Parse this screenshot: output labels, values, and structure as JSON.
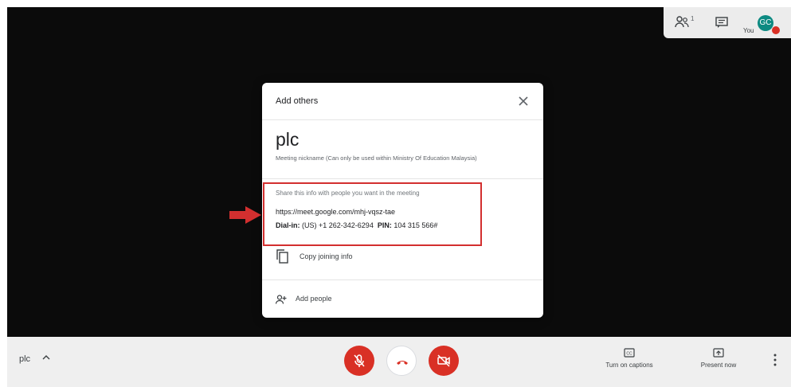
{
  "top_panel": {
    "participants_icon": "people-icon",
    "participant_count": "1",
    "chat_icon": "chat-icon",
    "you_label": "You",
    "avatar_initials": "GC"
  },
  "dialog": {
    "title": "Add others",
    "close_icon": "close-icon",
    "nickname": "plc",
    "nickname_note": "Meeting nickname (Can only be used within Ministry Of Education Malaysia)",
    "share_note": "Share this info with people you want in the meeting",
    "meet_url": "https://meet.google.com/mhj-vqsz-tae",
    "dial_in_label": "Dial-in:",
    "dial_in_value": "(US) +1 262-342-6294",
    "pin_label": "PIN:",
    "pin_value": "104 315 566#",
    "copy_label": "Copy joining info",
    "copy_icon": "copy-icon",
    "add_people_label": "Add people",
    "add_people_icon": "person-add-icon"
  },
  "bottom_bar": {
    "meeting_name": "plc",
    "mic_icon": "mic-off-icon",
    "hangup_icon": "hang-up-icon",
    "camera_icon": "camera-off-icon",
    "captions_label": "Turn on captions",
    "present_label": "Present now",
    "more_icon": "more-vert-icon"
  },
  "colors": {
    "highlight": "#d32f2f",
    "control_red": "#d93025",
    "avatar": "#0d8a82"
  }
}
